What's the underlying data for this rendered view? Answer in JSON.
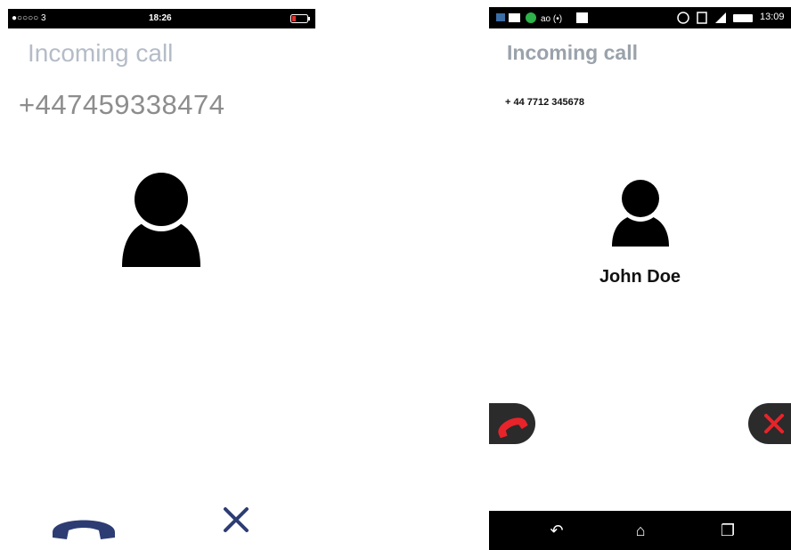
{
  "left_phone": {
    "status_bar": {
      "carrier": "●○○○○ 3",
      "time": "18:26"
    },
    "title": "Incoming call",
    "number": "+447459338474",
    "icons": {
      "avatar": "person-icon",
      "accept": "phone-handset-icon",
      "decline": "close-icon"
    },
    "colors": {
      "accent": "#2d3d73",
      "title": "#b4bcc7",
      "battery_low": "#e03030"
    }
  },
  "right_phone": {
    "status_bar": {
      "time": "13:09"
    },
    "title": "Incoming call",
    "number": "+ 44 7712 345678",
    "caller_name": "John Doe",
    "icons": {
      "avatar": "person-icon",
      "accept": "phone-handset-icon",
      "decline": "close-icon",
      "nav": [
        "back-icon",
        "home-icon",
        "recent-apps-icon"
      ]
    },
    "colors": {
      "button_bg": "#2b2b2b",
      "call_red": "#e8232a"
    },
    "nav_glyphs": [
      "↶",
      "⌂",
      "❐"
    ]
  }
}
